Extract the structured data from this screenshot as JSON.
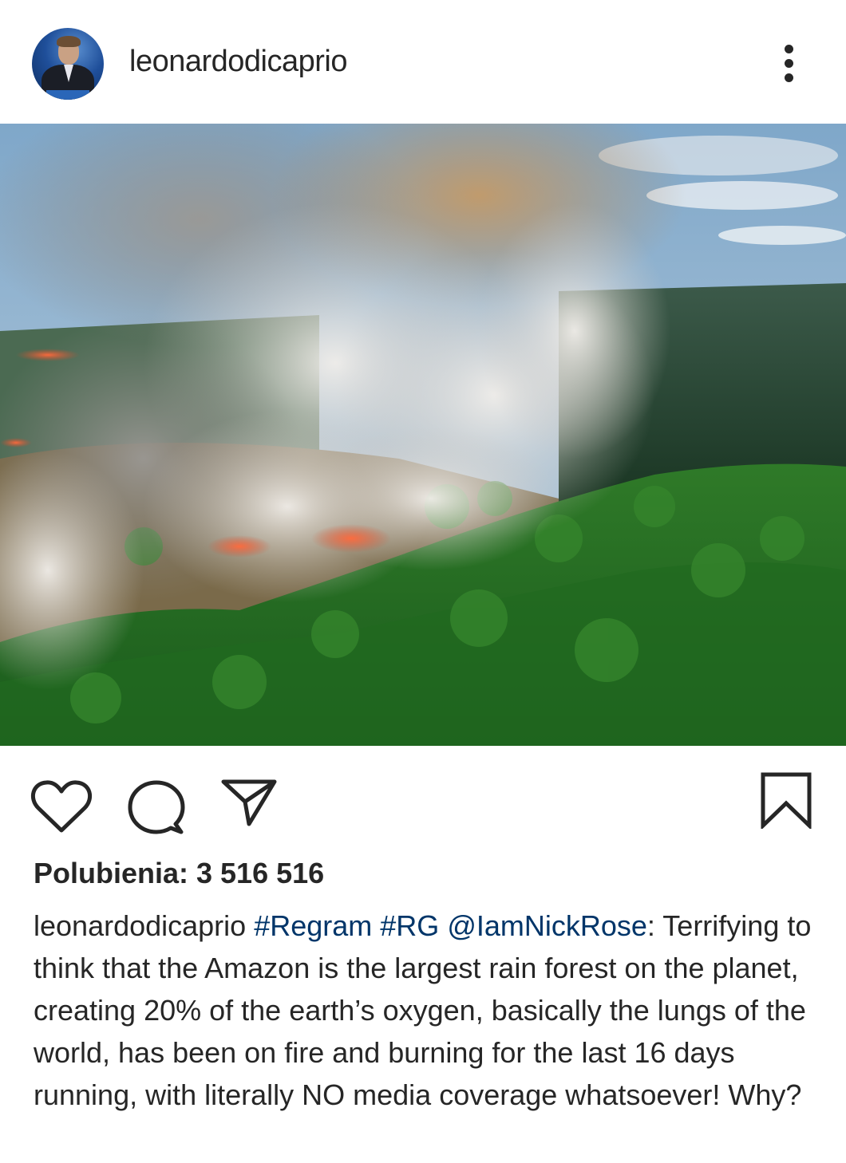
{
  "header": {
    "username": "leonardodicaprio",
    "avatar_icon": "profile-avatar",
    "more_icon": "more-vertical-icon"
  },
  "photo": {
    "icon": "amazon-forest-fire-aerial-photo"
  },
  "actions": {
    "like_icon": "heart-icon",
    "comment_icon": "comment-bubble-icon",
    "share_icon": "paper-plane-icon",
    "save_icon": "bookmark-icon"
  },
  "likes": {
    "text": "Polubienia: 3 516 516"
  },
  "caption": {
    "username": "leonardodicaprio",
    "tag1": "#Regram",
    "tag2": "#RG",
    "mention": "@IamNickRose",
    "colon": ":",
    "text": "Terrifying to think that the Amazon is the largest rain forest on the planet, creating 20% of the earth’s oxygen, basically the lungs of the world, has been on fire and burning for the last 16 days running, with literally NO media coverage whatsoever! Why?",
    "link_color": "#003569"
  }
}
